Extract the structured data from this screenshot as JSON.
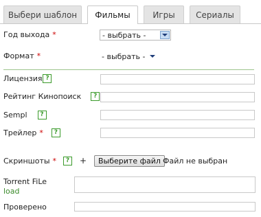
{
  "tabs": [
    {
      "label": "Выбери шаблон"
    },
    {
      "label": "Фильмы"
    },
    {
      "label": "Игры"
    },
    {
      "label": "Сериалы"
    }
  ],
  "form": {
    "year": {
      "label": "Год выхода",
      "value": "- выбрать -"
    },
    "format": {
      "label": "Формат",
      "value": "- выбрать -"
    },
    "license": {
      "label": "Лицензия"
    },
    "kinopoisk": {
      "label": "Рейтинг Кинопоиск"
    },
    "sempl": {
      "label": "Sempl"
    },
    "trailer": {
      "label": "Трейлер"
    },
    "screenshots": {
      "label": "Скриншоты",
      "plus": "+",
      "button": "Выберите файл",
      "status": "Файл не выбран"
    },
    "torrent": {
      "label": "Torrent FiLe",
      "load": "load"
    },
    "checked": {
      "label": "Проверено"
    }
  },
  "required_mark": "*",
  "help_mark": "?",
  "colors": {
    "required": "#cc0000",
    "help": "#3a9a2a",
    "separator": "#9cc48c"
  }
}
